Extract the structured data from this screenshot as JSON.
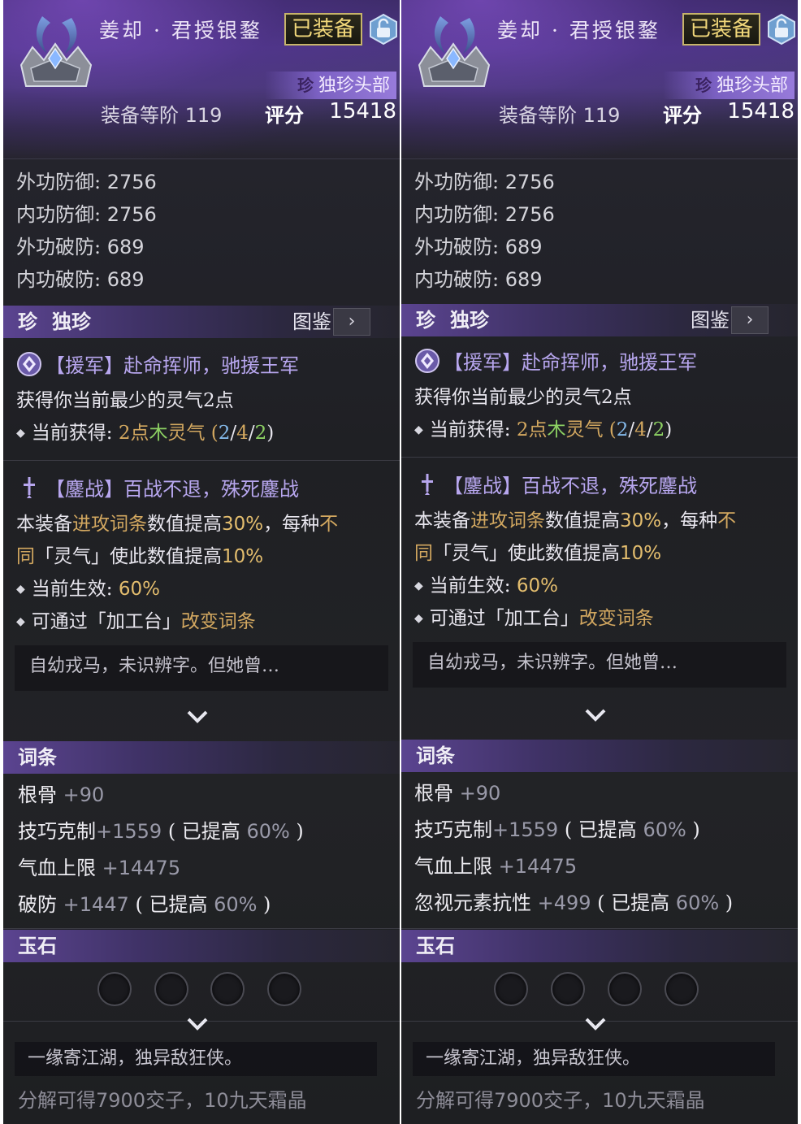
{
  "panels": [
    {
      "item_name": "姜却 · 君授银鍪",
      "equipped_label": "已装备",
      "rarity_mark": "珍",
      "item_type": "独珍头部",
      "grade_label": "装备等阶",
      "grade_value": "119",
      "score_label": "评分",
      "score_value": "15418",
      "base_stats": [
        {
          "label": "外功防御: ",
          "value": "2756"
        },
        {
          "label": "内功防御: ",
          "value": "2756"
        },
        {
          "label": "外功破防: ",
          "value": "689"
        },
        {
          "label": "内功破防: ",
          "value": "689"
        }
      ],
      "rarity_section": {
        "mark": "珍",
        "label": "独珍",
        "codex_label": "图鉴",
        "codex_arrow": "›"
      },
      "effect1": {
        "title": "【援军】赴命挥师，驰援王军",
        "desc": "获得你当前最少的灵气2点",
        "current_label": "当前获得: ",
        "current_pre": "2点",
        "current_elem": "木",
        "current_post": "灵气 (",
        "ratio": [
          "2",
          "4",
          "2"
        ],
        "ratio_close": ")"
      },
      "effect2": {
        "title": "【鏖战】百战不退，殊死鏖战",
        "line1_a": "本装备",
        "line1_b": "进攻词条",
        "line1_c": "数值提高",
        "line1_d": "30%",
        "line1_e": "，每种",
        "line1_f": "不",
        "line2_a": "同",
        "line2_b": "「灵气」使此数值提高",
        "line2_c": "10%",
        "current_label": "当前生效: ",
        "current_value": "60%",
        "modify_a": "可通过「加工台」",
        "modify_b": "改变词条"
      },
      "lore": "自幼戎马，未识辨字。但她曾…",
      "attr_section": "词条",
      "attrs": [
        {
          "name": "根骨",
          "value": " +90",
          "extra": ""
        },
        {
          "name": "技巧克制",
          "value": "+1559",
          "extra": "60%"
        },
        {
          "name": "气血上限",
          "value": " +14475",
          "extra": ""
        },
        {
          "name": "破防",
          "value": " +1447",
          "extra": "60%"
        }
      ],
      "boost_open": " ( 已提高 ",
      "boost_close": " )",
      "gem_section": "玉石",
      "footer_quote": "一缘寄江湖，独异敌狂侠。",
      "disassemble_a": "分解可得",
      "disassemble_b": "7900",
      "disassemble_c": "交子，",
      "disassemble_d": "10",
      "disassemble_e": "九天霜晶"
    },
    {
      "item_name": "姜却 · 君授银鍪",
      "equipped_label": "已装备",
      "rarity_mark": "珍",
      "item_type": "独珍头部",
      "grade_label": "装备等阶",
      "grade_value": "119",
      "score_label": "评分",
      "score_value": "15418",
      "base_stats": [
        {
          "label": "外功防御: ",
          "value": "2756"
        },
        {
          "label": "内功防御: ",
          "value": "2756"
        },
        {
          "label": "外功破防: ",
          "value": "689"
        },
        {
          "label": "内功破防: ",
          "value": "689"
        }
      ],
      "rarity_section": {
        "mark": "珍",
        "label": "独珍",
        "codex_label": "图鉴",
        "codex_arrow": "›"
      },
      "effect1": {
        "title": "【援军】赴命挥师，驰援王军",
        "desc": "获得你当前最少的灵气2点",
        "current_label": "当前获得: ",
        "current_pre": "2点",
        "current_elem": "木",
        "current_post": "灵气 (",
        "ratio": [
          "2",
          "4",
          "2"
        ],
        "ratio_close": ")"
      },
      "effect2": {
        "title": "【鏖战】百战不退，殊死鏖战",
        "line1_a": "本装备",
        "line1_b": "进攻词条",
        "line1_c": "数值提高",
        "line1_d": "30%",
        "line1_e": "，每种",
        "line1_f": "不",
        "line2_a": "同",
        "line2_b": "「灵气」使此数值提高",
        "line2_c": "10%",
        "current_label": "当前生效: ",
        "current_value": "60%",
        "modify_a": "可通过「加工台」",
        "modify_b": "改变词条"
      },
      "lore": "自幼戎马，未识辨字。但她曾…",
      "attr_section": "词条",
      "attrs": [
        {
          "name": "根骨",
          "value": " +90",
          "extra": ""
        },
        {
          "name": "技巧克制",
          "value": "+1559",
          "extra": "60%"
        },
        {
          "name": "气血上限",
          "value": " +14475",
          "extra": ""
        },
        {
          "name": "忽视元素抗性",
          "value": " +499",
          "extra": "60%"
        }
      ],
      "boost_open": " ( 已提高 ",
      "boost_close": " )",
      "gem_section": "玉石",
      "footer_quote": "一缘寄江湖，独异敌狂侠。",
      "disassemble_a": "分解可得",
      "disassemble_b": "7900",
      "disassemble_c": "交子，",
      "disassemble_d": "10",
      "disassemble_e": "九天霜晶"
    }
  ],
  "colors": {
    "header_purple": "#4c3682",
    "effect_title": "#b7a6ee",
    "gold": "#d3a860",
    "wood_green": "#8dd163",
    "ratio_blue": "#84b8e8",
    "badge_gold": "#f1d77a"
  },
  "icons": [
    "helmet-icon",
    "lock-icon",
    "gem-effect-icon",
    "sword-effect-icon",
    "chevron-right-icon",
    "chevron-down-icon"
  ]
}
